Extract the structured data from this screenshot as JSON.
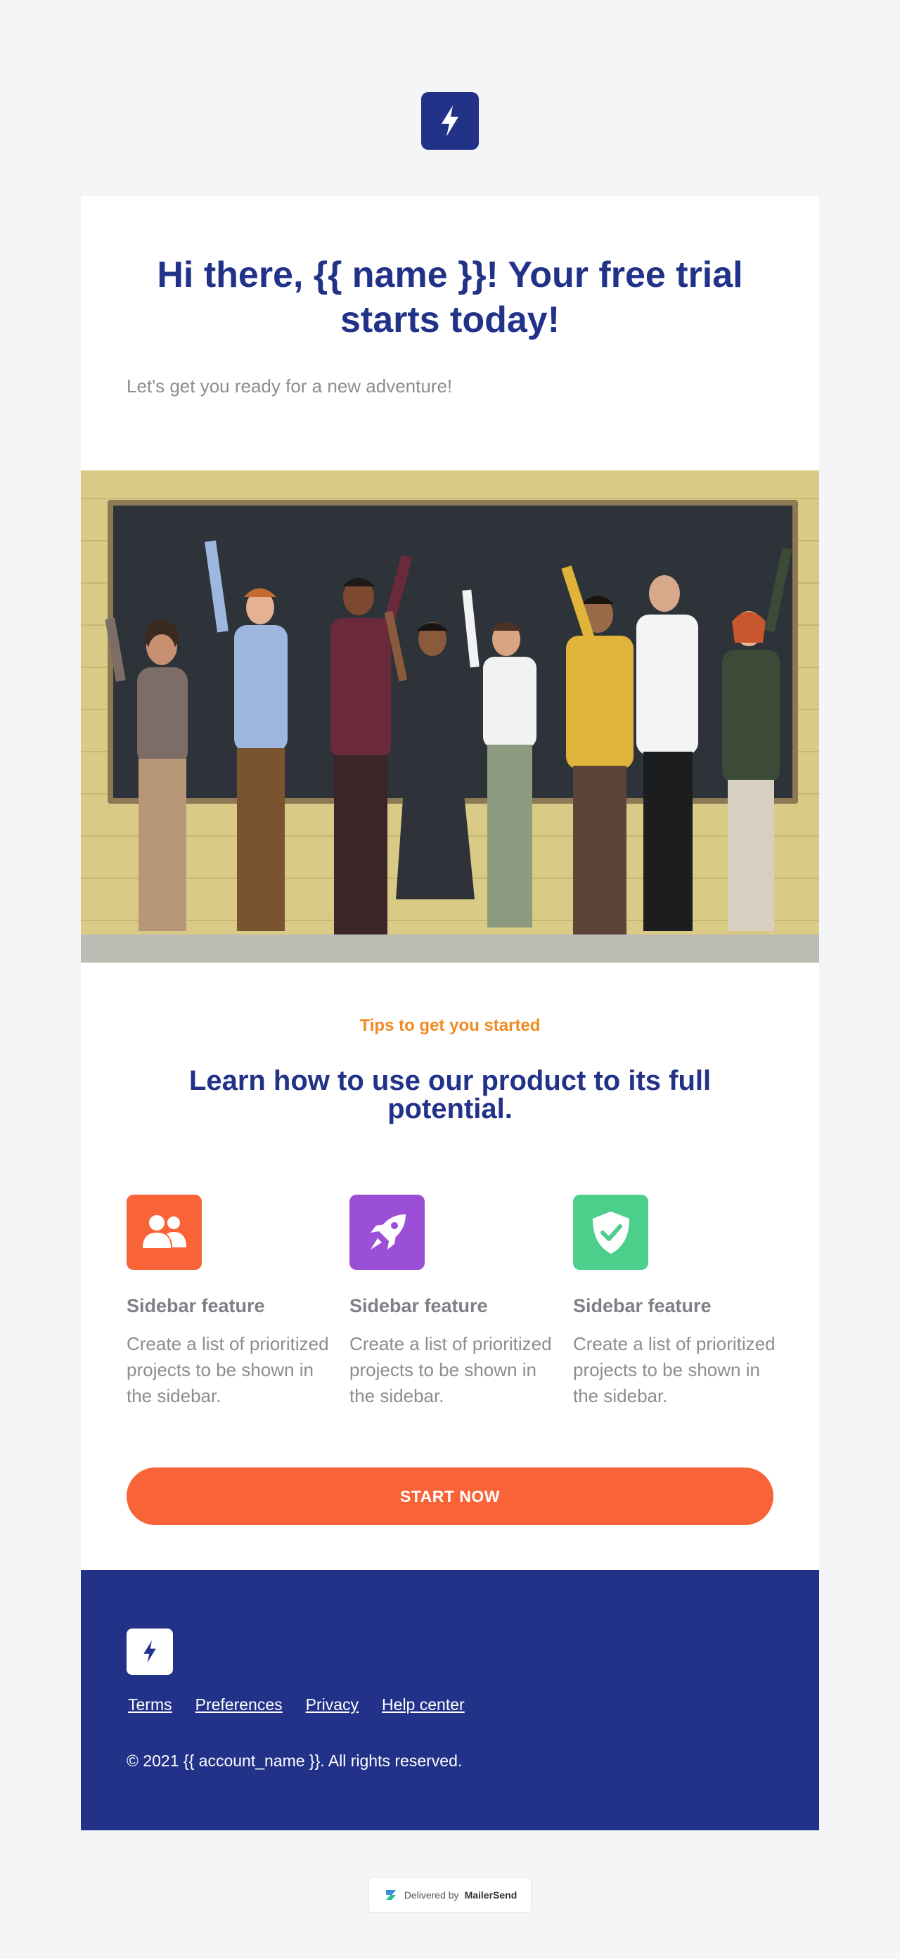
{
  "logo": {
    "icon": "bolt-icon"
  },
  "hero": {
    "title": "Hi there, {{ name }}! Your free trial starts today!",
    "subtitle": "Let's get you ready for a new adventure!"
  },
  "photo": {
    "description_icon": "team-photo"
  },
  "tips": {
    "kicker": "Tips to get you started",
    "title": "Learn how to use our product to its full potential."
  },
  "features": [
    {
      "icon": "users-icon",
      "color": "#f86337",
      "title": "Sidebar feature",
      "description": "Create a list of prioritized projects to be shown in the sidebar."
    },
    {
      "icon": "rocket-icon",
      "color": "#9b4fd6",
      "title": "Sidebar feature",
      "description": "Create a list of prioritized projects to be shown in the sidebar."
    },
    {
      "icon": "shield-check-icon",
      "color": "#4ccf8a",
      "title": "Sidebar feature",
      "description": "Create a list of prioritized projects to be shown in the sidebar."
    }
  ],
  "cta": {
    "label": "START NOW"
  },
  "footer": {
    "links": [
      "Terms",
      "Preferences",
      "Privacy",
      "Help center"
    ],
    "copyright": "© 2021 {{ account_name }}. All rights reserved."
  },
  "badge": {
    "prefix": "Delivered by",
    "brand": "MailerSend"
  },
  "colors": {
    "brand": "#223289",
    "accent": "#f86337",
    "kicker": "#f08a24",
    "background": "#f4f5f7"
  }
}
